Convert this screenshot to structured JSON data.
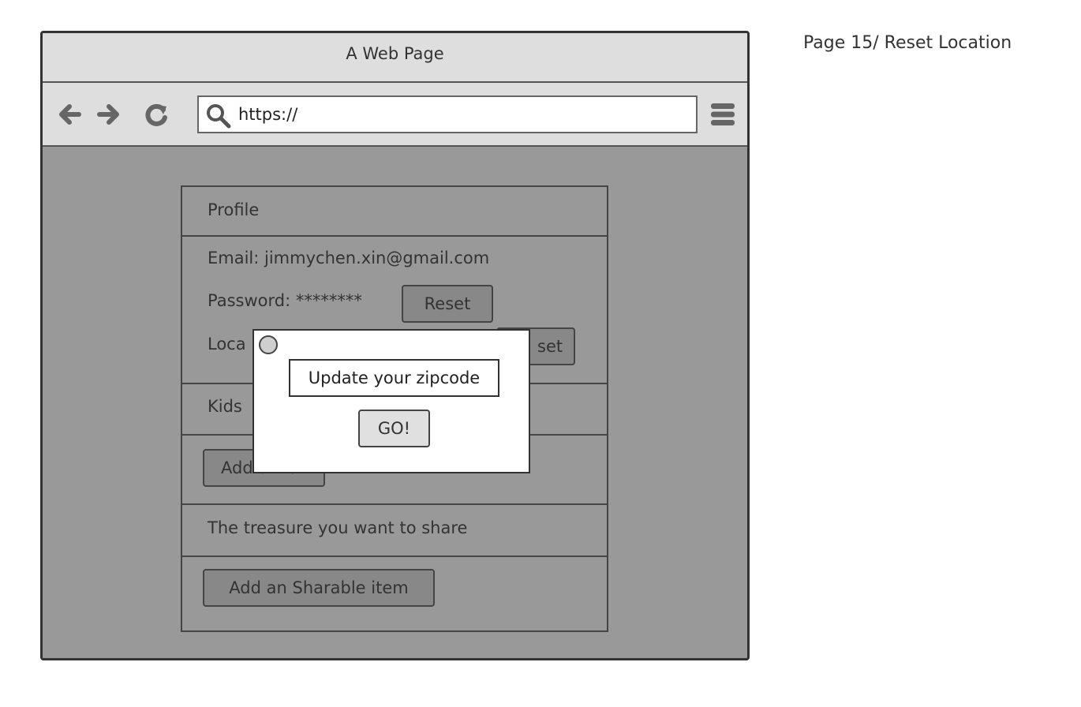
{
  "page_label": "Page 15/ Reset Location",
  "browser": {
    "title": "A Web Page",
    "url": "https://",
    "icons": {
      "back": "arrow-left-icon",
      "forward": "arrow-right-icon",
      "reload": "reload-icon",
      "search": "search-icon",
      "menu": "hamburger-menu-icon"
    }
  },
  "profile": {
    "header": "Profile",
    "email_text": "Email: jimmychen.xin@gmail.com",
    "password_text": "Password: ********",
    "password_reset_label": "Reset",
    "location_text_visible": "Loca",
    "location_reset_visible": "set",
    "kids_header_visible": "Kids",
    "add_kid_visible": "Add a kid",
    "treasure_header": "The treasure you want to share",
    "add_item_label": "Add an Sharable item"
  },
  "modal": {
    "field_text": "Update your zipcode",
    "go_label": "GO!"
  },
  "colors": {
    "overlay_background": "#999999",
    "toolbar_background": "#dedede",
    "button_background": "#888888",
    "modal_background": "#ffffff",
    "border": "#333333"
  }
}
